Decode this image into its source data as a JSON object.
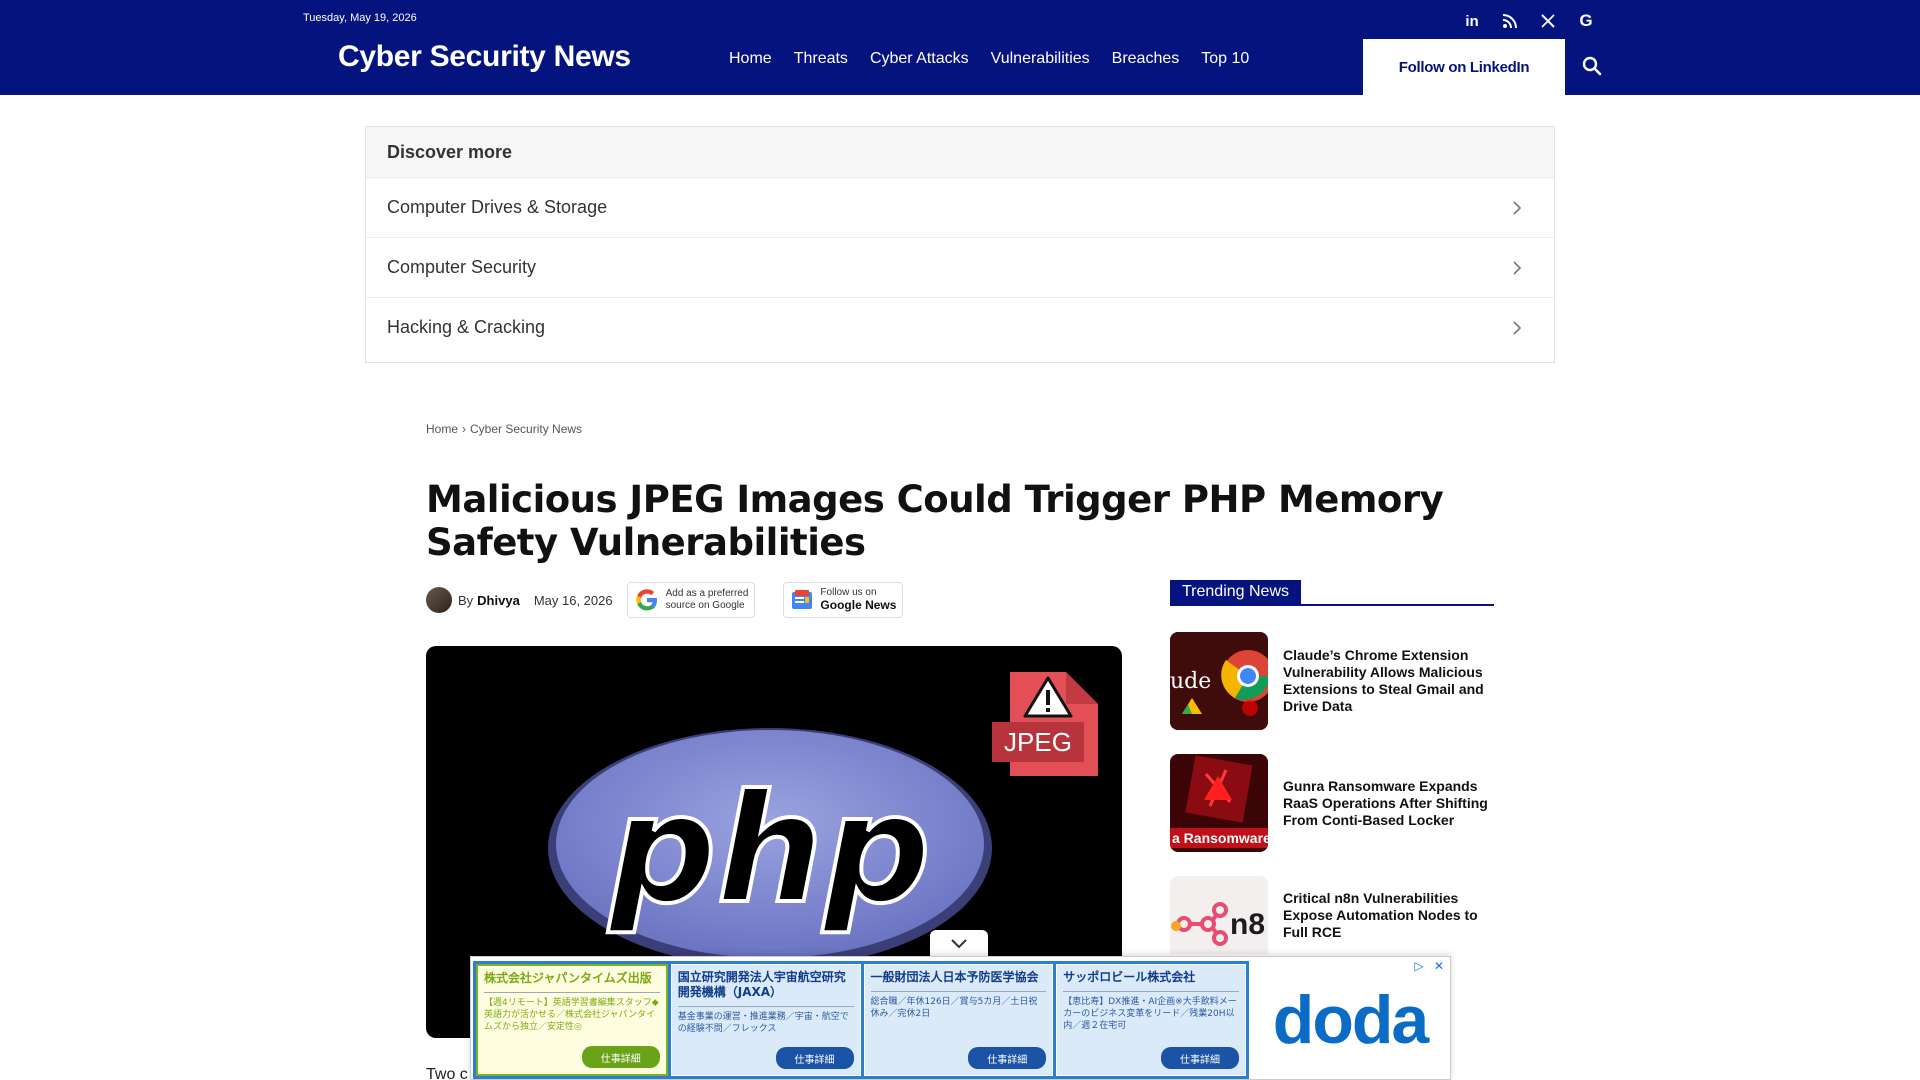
{
  "header": {
    "date": "Tuesday, May 19, 2026",
    "logo": "Cyber Security News",
    "nav": [
      "Home",
      "Threats",
      "Cyber Attacks",
      "Vulnerabilities",
      "Breaches",
      "Top 10"
    ],
    "follow_label": "Follow on LinkedIn",
    "social": [
      {
        "label": "in",
        "icon": "linkedin-icon"
      },
      {
        "label": "rss",
        "icon": "rss-icon"
      },
      {
        "label": "X",
        "icon": "x-icon"
      },
      {
        "label": "G",
        "icon": "google-icon"
      }
    ],
    "bg_color": "#05137f"
  },
  "discover": {
    "heading": "Discover more",
    "items": [
      "Computer Drives & Storage",
      "Computer Security",
      "Hacking & Cracking"
    ]
  },
  "breadcrumb": [
    "Home",
    "Cyber Security News"
  ],
  "article": {
    "title": "Malicious JPEG Images Could Trigger PHP Memory Safety Vulnerabilities",
    "by": "By",
    "author": "Dhivya",
    "date": "May 16, 2026",
    "badge_google_line1": "Add as a preferred",
    "badge_google_line2": "source on Google",
    "badge_news_line1": "Follow us on",
    "badge_news_line2": "Google News",
    "hero_text_php": "php",
    "hero_text_jpeg": "JPEG",
    "body_start": "Two c"
  },
  "trending": {
    "heading": "Trending News",
    "items": [
      {
        "title": "Claude’s Chrome Extension Vulnerability Allows Malicious Extensions to Steal Gmail and Drive Data",
        "thumb_text": "ude"
      },
      {
        "title": "Gunra Ransomware Expands RaaS Operations After Shifting From Conti-Based Locker",
        "thumb_text": "a Ransomware"
      },
      {
        "title": "Critical n8n Vulnerabilities Expose Automation Nodes to Full RCE",
        "thumb_text": "n8"
      }
    ]
  },
  "ad": {
    "cards": [
      {
        "company": "株式会社ジャパンタイムズ出版",
        "desc": "【週4リモート】英語学習書編集スタッフ◆英語力が活かせる／株式会社ジャパンタイムズから独立／安定性◎",
        "cta": "仕事詳細"
      },
      {
        "company": "国立研究開発法人宇宙航空研究開発機構（JAXA）",
        "desc": "基金事業の運営・推進業務／宇宙・航空での経験不問／フレックス",
        "cta": "仕事詳細"
      },
      {
        "company": "一般財団法人日本予防医学協会",
        "desc": "総合職／年休126日／賞与5カ月／土日祝休み／完休2日",
        "cta": "仕事詳細"
      },
      {
        "company": "サッポロビール株式会社",
        "desc": "【恵比寿】DX推進・AI企画※大手飲料メーカーのビジネス変革をリード／残業20H以内／週２在宅可",
        "cta": "仕事詳細"
      }
    ],
    "logo": "doda",
    "adchoices": "▷",
    "close": "✕"
  }
}
